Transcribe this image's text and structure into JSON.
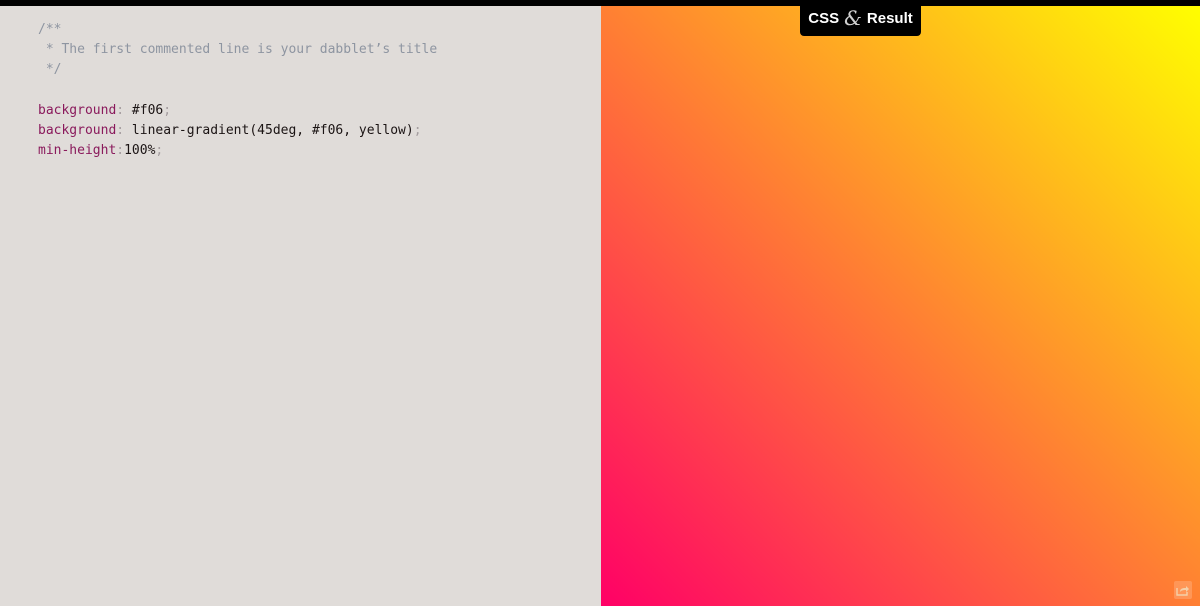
{
  "mode_switch": {
    "left": "CSS",
    "amp": "&",
    "right": "Result"
  },
  "editor": {
    "comment_open": "/**",
    "comment_body": " * The first commented line is your dabblet’s title",
    "comment_close": " */",
    "decl1": {
      "prop": "background",
      "colon": ":",
      "value": " #f06",
      "semi": ";"
    },
    "decl2": {
      "prop": "background",
      "colon": ":",
      "value": " linear-gradient(45deg, #f06, yellow)",
      "semi": ";"
    },
    "decl3": {
      "prop": "min-height",
      "colon": ":",
      "value": "100%",
      "semi": ";"
    }
  },
  "result": {
    "gradient_angle": "45deg",
    "gradient_start": "#f06",
    "gradient_end": "yellow"
  },
  "icons": {
    "share": "share-icon"
  },
  "colors": {
    "editor_bg": "#e0dcd9",
    "comment": "#8e95a1",
    "property": "#8a1a5c",
    "punctuation": "#a59ea0"
  }
}
